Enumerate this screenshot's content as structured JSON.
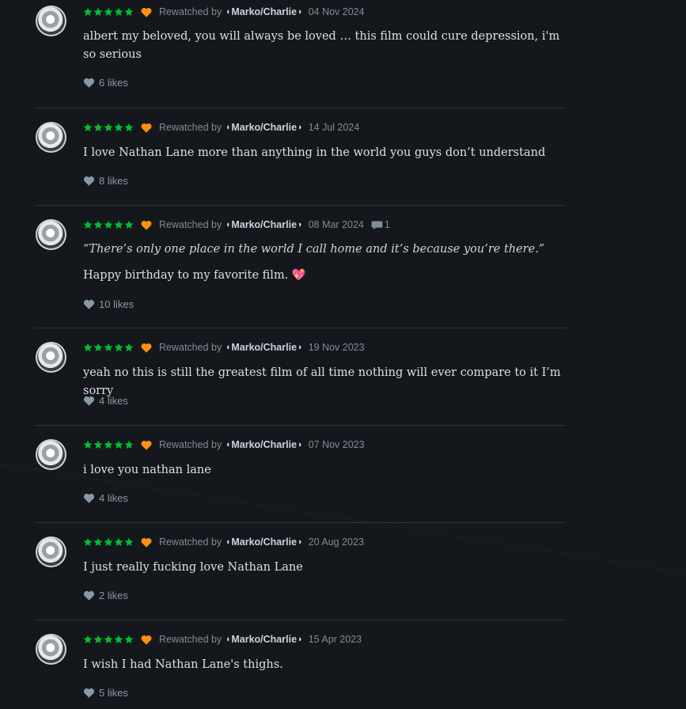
{
  "colors": {
    "star": "#00c030",
    "heart_rating": "#ff9010",
    "background": "#14181c",
    "emoji_heart": "#e8336e"
  },
  "icons": {
    "rating": "star-icon",
    "liked": "heart-icon",
    "like": "like-heart-icon",
    "comment": "comment-icon"
  },
  "reviews": [
    {
      "rating": 5,
      "status": "Rewatched by",
      "author": "Marko/Charlie",
      "date": "04 Nov 2024",
      "text": "albert my beloved, you will always be loved … this film could cure depression, i'm so serious",
      "likes": "6 likes"
    },
    {
      "rating": 5,
      "status": "Rewatched by",
      "author": "Marko/Charlie",
      "date": "14 Jul 2024",
      "text": "I love Nathan Lane more than anything in the world you guys don’t understand",
      "likes": "8 likes"
    },
    {
      "rating": 5,
      "status": "Rewatched by",
      "author": "Marko/Charlie",
      "date": "08 Mar 2024",
      "comments": "1",
      "quote": "“There’s only one place in the world I call home and it’s because you’re there.”",
      "text": "Happy birthday to my favorite film.",
      "emoji": "💖",
      "likes": "10 likes"
    },
    {
      "rating": 5,
      "status": "Rewatched by",
      "author": "Marko/Charlie",
      "date": "19 Nov 2023",
      "text": "yeah no this is still the greatest film of all time nothing will ever compare to it I’m sorry",
      "likes": "4 likes"
    },
    {
      "rating": 5,
      "status": "Rewatched by",
      "author": "Marko/Charlie",
      "date": "07 Nov 2023",
      "text": "i love you nathan lane",
      "likes": "4 likes"
    },
    {
      "rating": 5,
      "status": "Rewatched by",
      "author": "Marko/Charlie",
      "date": "20 Aug 2023",
      "text": "I just really fucking love Nathan Lane",
      "likes": "2 likes"
    },
    {
      "rating": 5,
      "status": "Rewatched by",
      "author": "Marko/Charlie",
      "date": "15 Apr 2023",
      "text": "I wish I had Nathan Lane's thighs.",
      "likes": "5 likes"
    }
  ]
}
